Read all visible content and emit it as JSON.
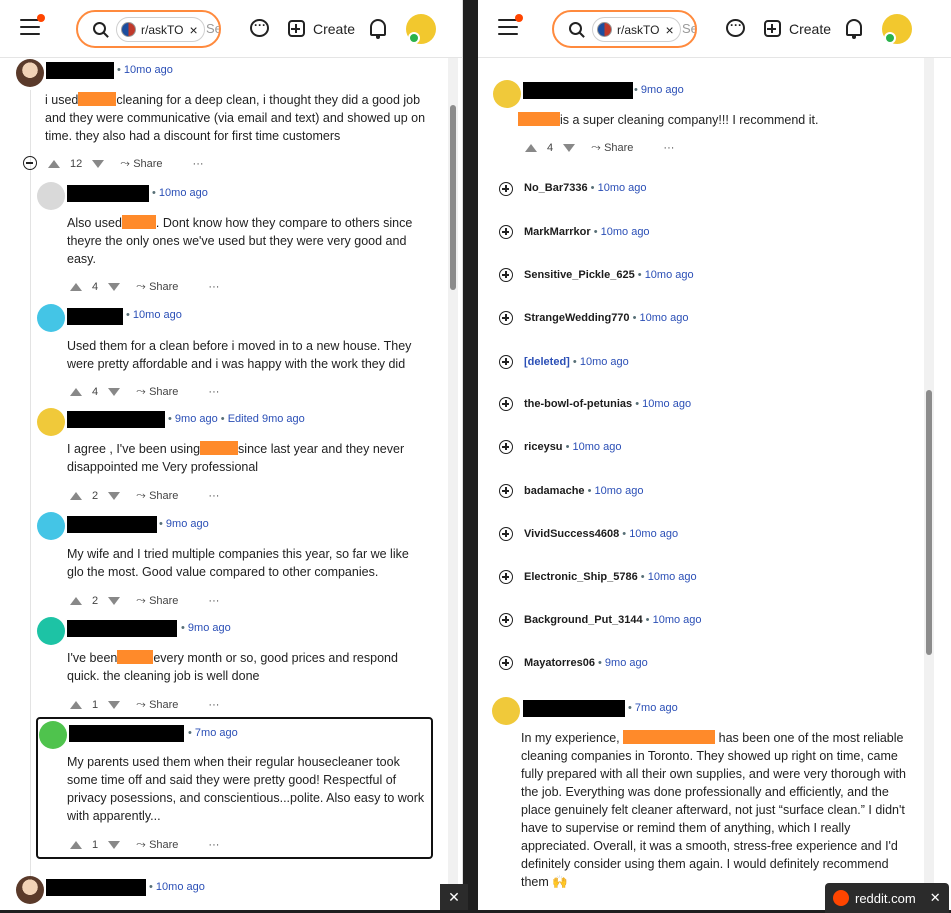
{
  "header": {
    "subreddit": "r/askTO",
    "search_placeholder": "Se",
    "create_label": "Create",
    "chip_close": "×"
  },
  "left": {
    "comments": [
      {
        "time": "10mo ago",
        "text_before": "i used",
        "text_after": "cleaning for a deep clean, i thought they did a good job and they were communicative (via email and text) and showed up on time. they also had a discount for first time customers",
        "votes": "12",
        "share": "Share"
      },
      {
        "time": "10mo ago",
        "text_before": "Also used",
        "text_after": ". Dont know how they compare to others since theyre the only ones we've used but they were very good and easy.",
        "votes": "4",
        "share": "Share"
      },
      {
        "time": "10mo ago",
        "text_before": "",
        "text_after": "Used them for a clean before i moved in to a new house. They were pretty affordable and i was happy with the work they did",
        "votes": "4",
        "share": "Share"
      },
      {
        "time": "9mo ago",
        "edited": "Edited 9mo ago",
        "text_before": "I agree , I've been using",
        "text_after": "since last year and they never disappointed me Very professional",
        "votes": "2",
        "share": "Share"
      },
      {
        "time": "9mo ago",
        "text_before": "",
        "text_after": "My wife and I tried multiple companies this year, so far we like glo the most. Good value compared to other companies.",
        "votes": "2",
        "share": "Share"
      },
      {
        "time": "9mo ago",
        "text_before": "I've been",
        "text_after": "every month or so, good prices and respond quick. the cleaning job is well done",
        "votes": "1",
        "share": "Share"
      },
      {
        "time": "7mo ago",
        "text_before": "",
        "text_after": "My parents used them when their regular housecleaner took some time off and said they were pretty good! Respectful of privacy posessions, and conscientious...polite. Also easy to work with apparently...",
        "votes": "1",
        "share": "Share"
      },
      {
        "time": "10mo ago"
      }
    ]
  },
  "right": {
    "top": {
      "time": "9mo ago",
      "text_after": "is a super cleaning company!!! I recommend it.",
      "votes": "4",
      "share": "Share"
    },
    "collapsed": [
      {
        "name": "No_Bar7336",
        "time": "10mo ago"
      },
      {
        "name": "MarkMarrkor",
        "time": "10mo ago"
      },
      {
        "name": "Sensitive_Pickle_625",
        "time": "10mo ago"
      },
      {
        "name": "StrangeWedding770",
        "time": "10mo ago"
      },
      {
        "name": "[deleted]",
        "time": "10mo ago"
      },
      {
        "name": "the-bowl-of-petunias",
        "time": "10mo ago"
      },
      {
        "name": "riceysu",
        "time": "10mo ago"
      },
      {
        "name": "badamache",
        "time": "10mo ago"
      },
      {
        "name": "VividSuccess4608",
        "time": "10mo ago"
      },
      {
        "name": "Electronic_Ship_5786",
        "time": "10mo ago"
      },
      {
        "name": "Background_Put_3144",
        "time": "10mo ago"
      },
      {
        "name": "Mayatorres06",
        "time": "9mo ago"
      }
    ],
    "bottom": {
      "time": "7mo ago",
      "text_before": "In my experience,",
      "text_after": "has been one of the most reliable cleaning companies in Toronto. They showed up right on time, came fully prepared with all their own supplies, and were very thorough with the job. Everything was done professionally and efficiently, and the place genuinely felt cleaner afterward, not just “surface clean.” I didn't have to supervise or remind them of anything, which I really appreciated. Overall, it was a smooth, stress-free experience and I'd definitely consider using them again. I would definitely recommend them 🙌"
    }
  },
  "taskbar": {
    "site": "reddit.com",
    "close": "✕"
  },
  "colors": {
    "accent": "#ff4500",
    "highlight": "#ff8a2a",
    "link": "#2b4fb6"
  }
}
